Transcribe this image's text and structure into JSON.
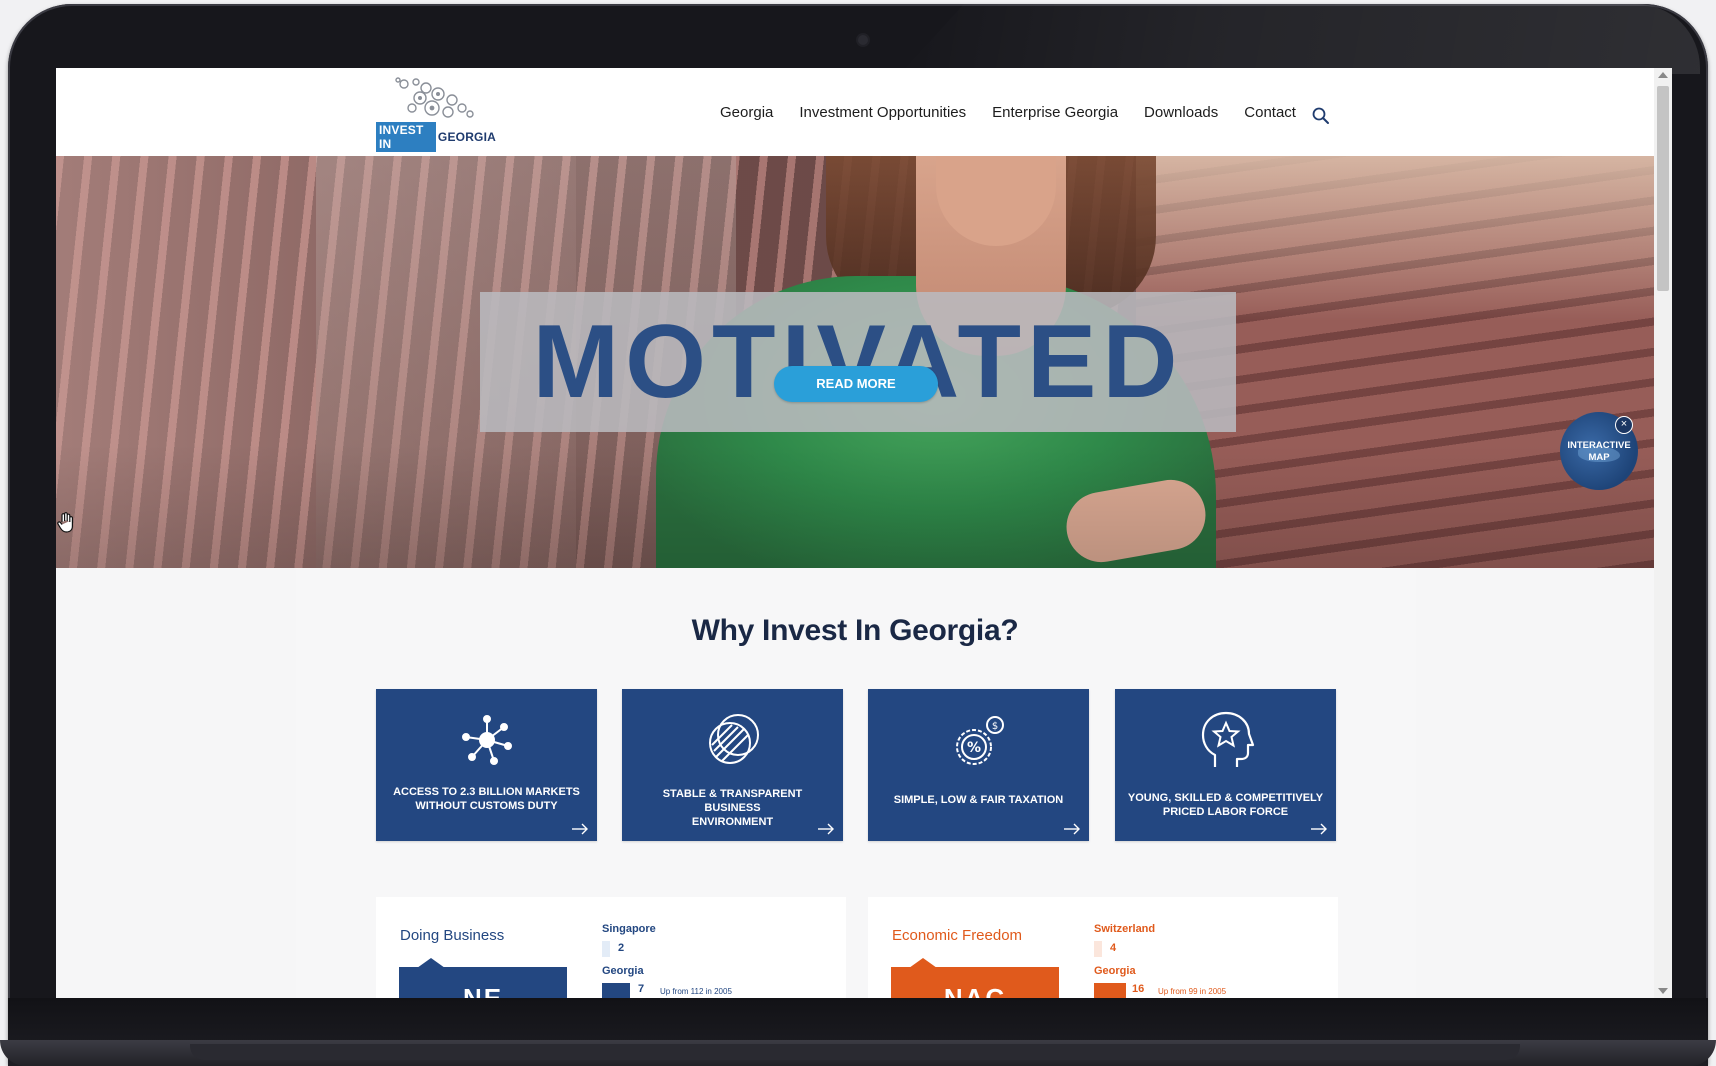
{
  "header": {
    "logo": {
      "tag": "INVEST IN",
      "country": "GEORGIA"
    },
    "nav": [
      "Georgia",
      "Investment Opportunities",
      "Enterprise Georgia",
      "Downloads",
      "Contact"
    ],
    "search_icon": "search-icon"
  },
  "hero": {
    "headline": "MOTIVATED",
    "button_label": "READ MORE",
    "map_widget": {
      "label_line1": "INTERACTIVE",
      "label_line2": "MAP",
      "close": "×"
    }
  },
  "why": {
    "title": "Why Invest In Georgia?",
    "cards": [
      {
        "line1": "ACCESS TO 2.3 BILLION MARKETS",
        "line2": "WITHOUT CUSTOMS DUTY",
        "icon": "network-icon"
      },
      {
        "line1": "STABLE & TRANSPARENT BUSINESS",
        "line2": "ENVIRONMENT",
        "icon": "globe-icon"
      },
      {
        "line1": "SIMPLE, LOW & FAIR TAXATION",
        "line2": "",
        "icon": "tax-percent-icon"
      },
      {
        "line1": "YOUNG, SKILLED & COMPETITIVELY",
        "line2": "PRICED LABOR FORCE",
        "icon": "head-star-icon"
      }
    ]
  },
  "panels": [
    {
      "title": "Doing Business",
      "color": "#234781",
      "tab_text": "NE",
      "top_country": "Singapore",
      "top_value": "2",
      "country": "Georgia",
      "value": "7",
      "note": "Up from 112 in 2005"
    },
    {
      "title": "Economic Freedom",
      "color": "#e05a1c",
      "tab_text": "NAC",
      "top_country": "Switzerland",
      "top_value": "4",
      "country": "Georgia",
      "value": "16",
      "note": "Up from 99 in 2005"
    }
  ]
}
